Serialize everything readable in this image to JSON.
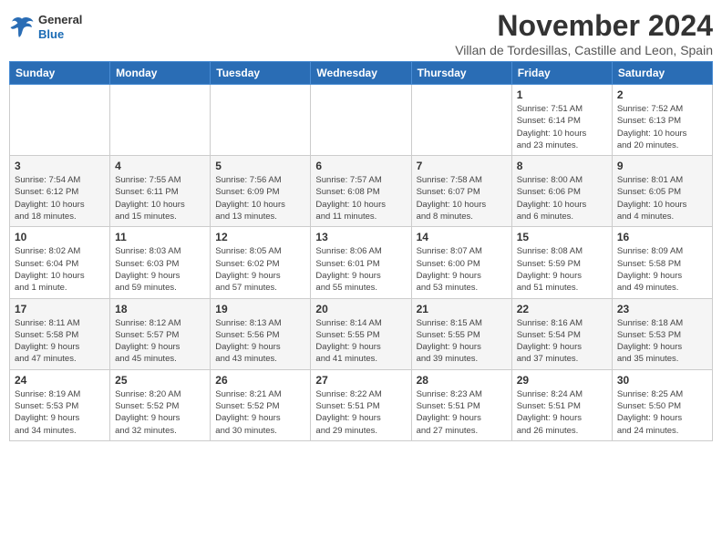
{
  "header": {
    "logo_general": "General",
    "logo_blue": "Blue",
    "month_title": "November 2024",
    "location": "Villan de Tordesillas, Castille and Leon, Spain"
  },
  "weekdays": [
    "Sunday",
    "Monday",
    "Tuesday",
    "Wednesday",
    "Thursday",
    "Friday",
    "Saturday"
  ],
  "weeks": [
    [
      {
        "day": "",
        "info": ""
      },
      {
        "day": "",
        "info": ""
      },
      {
        "day": "",
        "info": ""
      },
      {
        "day": "",
        "info": ""
      },
      {
        "day": "",
        "info": ""
      },
      {
        "day": "1",
        "info": "Sunrise: 7:51 AM\nSunset: 6:14 PM\nDaylight: 10 hours\nand 23 minutes."
      },
      {
        "day": "2",
        "info": "Sunrise: 7:52 AM\nSunset: 6:13 PM\nDaylight: 10 hours\nand 20 minutes."
      }
    ],
    [
      {
        "day": "3",
        "info": "Sunrise: 7:54 AM\nSunset: 6:12 PM\nDaylight: 10 hours\nand 18 minutes."
      },
      {
        "day": "4",
        "info": "Sunrise: 7:55 AM\nSunset: 6:11 PM\nDaylight: 10 hours\nand 15 minutes."
      },
      {
        "day": "5",
        "info": "Sunrise: 7:56 AM\nSunset: 6:09 PM\nDaylight: 10 hours\nand 13 minutes."
      },
      {
        "day": "6",
        "info": "Sunrise: 7:57 AM\nSunset: 6:08 PM\nDaylight: 10 hours\nand 11 minutes."
      },
      {
        "day": "7",
        "info": "Sunrise: 7:58 AM\nSunset: 6:07 PM\nDaylight: 10 hours\nand 8 minutes."
      },
      {
        "day": "8",
        "info": "Sunrise: 8:00 AM\nSunset: 6:06 PM\nDaylight: 10 hours\nand 6 minutes."
      },
      {
        "day": "9",
        "info": "Sunrise: 8:01 AM\nSunset: 6:05 PM\nDaylight: 10 hours\nand 4 minutes."
      }
    ],
    [
      {
        "day": "10",
        "info": "Sunrise: 8:02 AM\nSunset: 6:04 PM\nDaylight: 10 hours\nand 1 minute."
      },
      {
        "day": "11",
        "info": "Sunrise: 8:03 AM\nSunset: 6:03 PM\nDaylight: 9 hours\nand 59 minutes."
      },
      {
        "day": "12",
        "info": "Sunrise: 8:05 AM\nSunset: 6:02 PM\nDaylight: 9 hours\nand 57 minutes."
      },
      {
        "day": "13",
        "info": "Sunrise: 8:06 AM\nSunset: 6:01 PM\nDaylight: 9 hours\nand 55 minutes."
      },
      {
        "day": "14",
        "info": "Sunrise: 8:07 AM\nSunset: 6:00 PM\nDaylight: 9 hours\nand 53 minutes."
      },
      {
        "day": "15",
        "info": "Sunrise: 8:08 AM\nSunset: 5:59 PM\nDaylight: 9 hours\nand 51 minutes."
      },
      {
        "day": "16",
        "info": "Sunrise: 8:09 AM\nSunset: 5:58 PM\nDaylight: 9 hours\nand 49 minutes."
      }
    ],
    [
      {
        "day": "17",
        "info": "Sunrise: 8:11 AM\nSunset: 5:58 PM\nDaylight: 9 hours\nand 47 minutes."
      },
      {
        "day": "18",
        "info": "Sunrise: 8:12 AM\nSunset: 5:57 PM\nDaylight: 9 hours\nand 45 minutes."
      },
      {
        "day": "19",
        "info": "Sunrise: 8:13 AM\nSunset: 5:56 PM\nDaylight: 9 hours\nand 43 minutes."
      },
      {
        "day": "20",
        "info": "Sunrise: 8:14 AM\nSunset: 5:55 PM\nDaylight: 9 hours\nand 41 minutes."
      },
      {
        "day": "21",
        "info": "Sunrise: 8:15 AM\nSunset: 5:55 PM\nDaylight: 9 hours\nand 39 minutes."
      },
      {
        "day": "22",
        "info": "Sunrise: 8:16 AM\nSunset: 5:54 PM\nDaylight: 9 hours\nand 37 minutes."
      },
      {
        "day": "23",
        "info": "Sunrise: 8:18 AM\nSunset: 5:53 PM\nDaylight: 9 hours\nand 35 minutes."
      }
    ],
    [
      {
        "day": "24",
        "info": "Sunrise: 8:19 AM\nSunset: 5:53 PM\nDaylight: 9 hours\nand 34 minutes."
      },
      {
        "day": "25",
        "info": "Sunrise: 8:20 AM\nSunset: 5:52 PM\nDaylight: 9 hours\nand 32 minutes."
      },
      {
        "day": "26",
        "info": "Sunrise: 8:21 AM\nSunset: 5:52 PM\nDaylight: 9 hours\nand 30 minutes."
      },
      {
        "day": "27",
        "info": "Sunrise: 8:22 AM\nSunset: 5:51 PM\nDaylight: 9 hours\nand 29 minutes."
      },
      {
        "day": "28",
        "info": "Sunrise: 8:23 AM\nSunset: 5:51 PM\nDaylight: 9 hours\nand 27 minutes."
      },
      {
        "day": "29",
        "info": "Sunrise: 8:24 AM\nSunset: 5:51 PM\nDaylight: 9 hours\nand 26 minutes."
      },
      {
        "day": "30",
        "info": "Sunrise: 8:25 AM\nSunset: 5:50 PM\nDaylight: 9 hours\nand 24 minutes."
      }
    ]
  ]
}
